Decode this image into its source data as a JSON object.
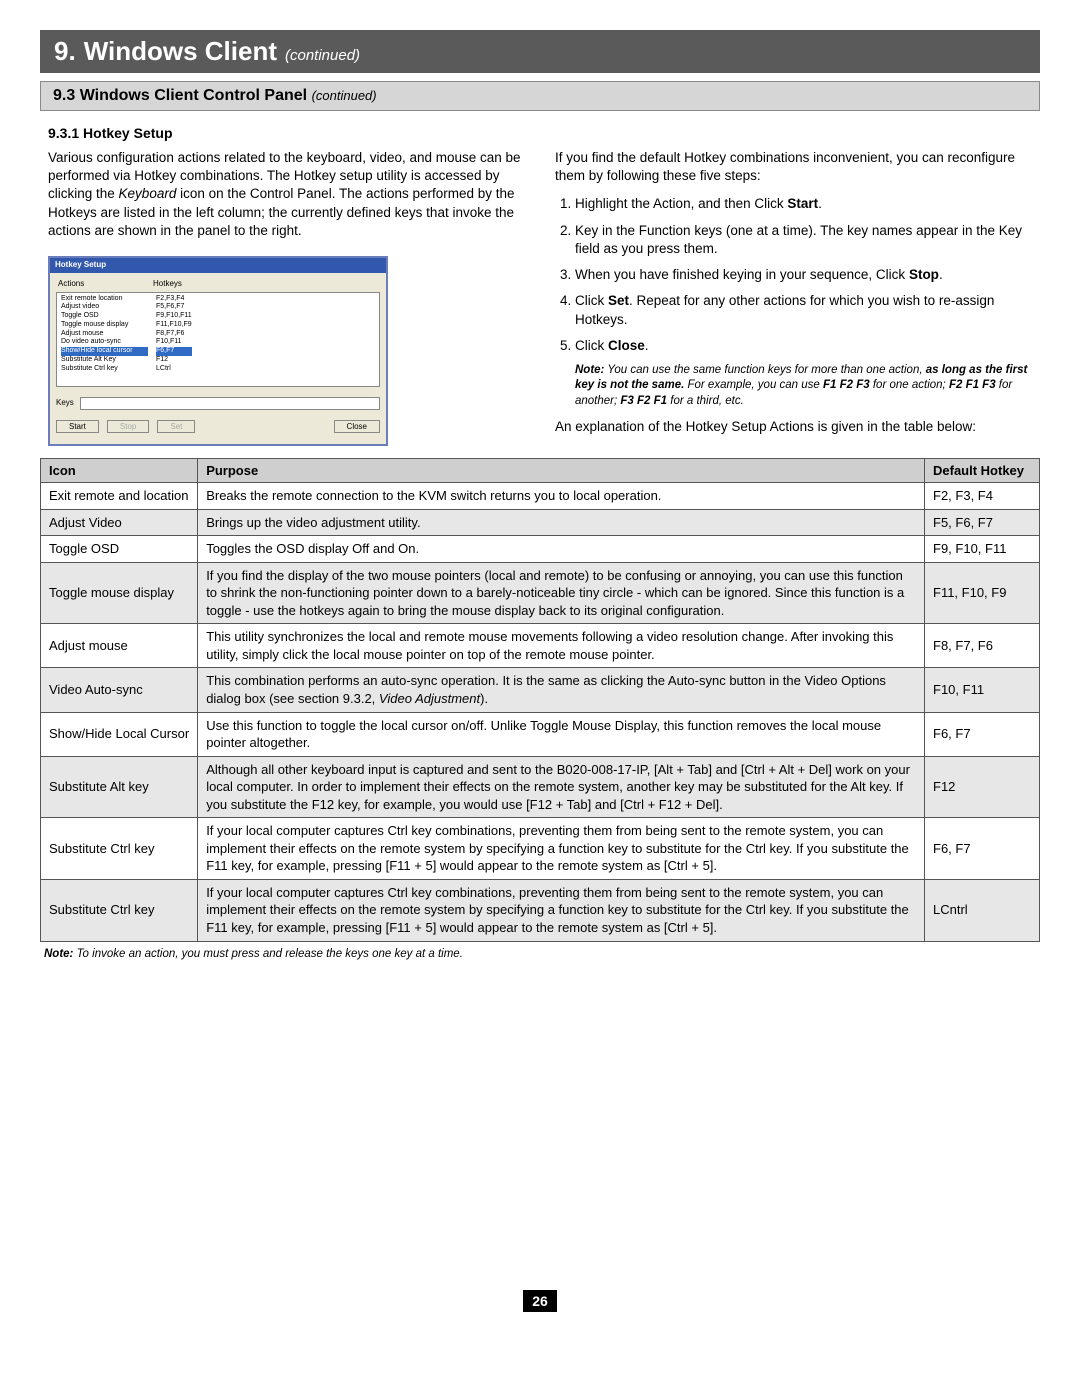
{
  "chapter": {
    "num": "9.",
    "title": "Windows Client",
    "cont": "(continued)"
  },
  "section": {
    "num": "9.3",
    "title": "Windows Client Control Panel",
    "cont": "(continued)"
  },
  "subsection": "9.3.1 Hotkey Setup",
  "left_para": "Various configuration actions related to the keyboard, video, and mouse can be performed via Hotkey combinations. The Hotkey setup utility is accessed by clicking the Keyboard icon on the Control Panel. The actions performed by the Hotkeys are listed in the left column; the currently defined keys that invoke the actions are shown in the panel to the right.",
  "left_para_italic_word": "Keyboard",
  "right_intro": "If you find the default Hotkey combinations inconvenient, you can reconfigure them by following these five steps:",
  "steps": [
    {
      "pre": "Highlight the Action, and then Click ",
      "bold": "Start",
      "post": "."
    },
    {
      "text": "Key in the Function keys (one at a time). The key names appear in the Key field as you press them."
    },
    {
      "pre": "When you have finished keying in your sequence, Click ",
      "bold": "Stop",
      "post": "."
    },
    {
      "pre": "Click ",
      "bold": "Set",
      "post": ". Repeat for any other actions for which you wish to re-assign Hotkeys."
    },
    {
      "pre": "Click ",
      "bold": "Close",
      "post": "."
    }
  ],
  "note1": {
    "label": "Note:",
    "a": " You can use the same function keys for more than one action, ",
    "em": "as long as the first key is not the same.",
    "b": " For example, you can use ",
    "k1": "F1 F2 F3",
    "c": " for one action; ",
    "k2": "F2 F1 F3",
    "d": " for another; ",
    "k3": "F3 F2 F1",
    "e": " for a third, etc."
  },
  "right_outro": "An explanation of the Hotkey Setup Actions is given in the table below:",
  "screenshot": {
    "title": "Hotkey Setup",
    "col1": "Actions",
    "col2": "Hotkeys",
    "rows": [
      {
        "a": "Exit remote location",
        "h": "F2,F3,F4"
      },
      {
        "a": "Adjust video",
        "h": "F5,F6,F7"
      },
      {
        "a": "Toggle OSD",
        "h": "F9,F10,F11"
      },
      {
        "a": "Toggle mouse display",
        "h": "F11,F10,F9"
      },
      {
        "a": "Adjust mouse",
        "h": "F8,F7,F6"
      },
      {
        "a": "Do video auto-sync",
        "h": "F10,F11"
      },
      {
        "a": "Show/Hide local cursor",
        "h": "F6,F7",
        "sel": true
      },
      {
        "a": "Substitute Alt Key",
        "h": "F12"
      },
      {
        "a": "Substitute Ctrl key",
        "h": "LCtrl"
      }
    ],
    "keys_label": "Keys",
    "btn_start": "Start",
    "btn_stop": "Stop",
    "btn_set": "Set",
    "btn_close": "Close"
  },
  "th": {
    "icon": "Icon",
    "purpose": "Purpose",
    "hotkey": "Default Hotkey"
  },
  "table": [
    {
      "shade": false,
      "icon": "Exit remote and location",
      "purpose": "Breaks the remote connection to the KVM switch returns you to local operation.",
      "hk": "F2, F3, F4"
    },
    {
      "shade": true,
      "icon": "Adjust Video",
      "purpose": "Brings up the video adjustment utility.",
      "hk": "F5, F6, F7"
    },
    {
      "shade": false,
      "icon": "Toggle OSD",
      "purpose": "Toggles the OSD display Off and On.",
      "hk": "F9, F10, F11"
    },
    {
      "shade": true,
      "icon": "Toggle mouse display",
      "purpose": "If you find the display of the two mouse pointers (local and remote) to be confusing or annoying, you can use this function to shrink the non-functioning pointer down to a barely-noticeable tiny circle - which can be ignored. Since this function is a toggle - use the hotkeys again to bring the mouse display back to its original configuration.",
      "hk": "F11, F10, F9"
    },
    {
      "shade": false,
      "icon": "Adjust mouse",
      "purpose": "This utility synchronizes the local and remote mouse movements following a video resolution change. After invoking this utility, simply click the local mouse pointer on top of the remote mouse pointer.",
      "hk": "F8, F7, F6"
    },
    {
      "shade": true,
      "icon": "Video Auto-sync",
      "purpose_a": "This combination performs an auto-sync operation. It is the same as clicking the Auto-sync button in the Video Options dialog box (see section 9.3.2, ",
      "purpose_i": "Video Adjustment",
      "purpose_b": ").",
      "hk": "F10, F11"
    },
    {
      "shade": false,
      "icon": "Show/Hide Local Cursor",
      "purpose": "Use this function to toggle the local cursor on/off. Unlike Toggle Mouse Display, this function removes the local mouse pointer altogether.",
      "hk": "F6, F7"
    },
    {
      "shade": true,
      "icon": "Substitute Alt key",
      "purpose": "Although all other keyboard input is captured and sent to the B020-008-17-IP, [Alt + Tab] and [Ctrl + Alt + Del] work on your local computer. In order to implement their effects on the remote system, another key may be substituted for the Alt key. If you substitute the F12 key, for example, you would use [F12 + Tab] and [Ctrl + F12 + Del].",
      "hk": "F12"
    },
    {
      "shade": false,
      "icon": "Substitute Ctrl key",
      "purpose": "If your local computer captures Ctrl key combinations, preventing them from being sent to the remote system, you can implement their effects on the remote system by specifying a function key to substitute for the Ctrl key. If you substitute the F11 key, for example, pressing [F11 + 5] would appear to the remote system as [Ctrl + 5].",
      "hk": "F6, F7"
    },
    {
      "shade": true,
      "icon": "Substitute Ctrl key",
      "purpose": "If your local computer captures Ctrl key combinations, preventing them from being sent to the remote system, you can implement their effects on the remote system by specifying a function key to substitute for the Ctrl key. If you substitute the F11 key, for example, pressing [F11 + 5] would appear to the remote system as [Ctrl + 5].",
      "hk": "LCntrl"
    }
  ],
  "footnote": {
    "label": "Note:",
    "text": " To invoke an action, you must press and release the keys one key at a time."
  },
  "page_num": "26"
}
